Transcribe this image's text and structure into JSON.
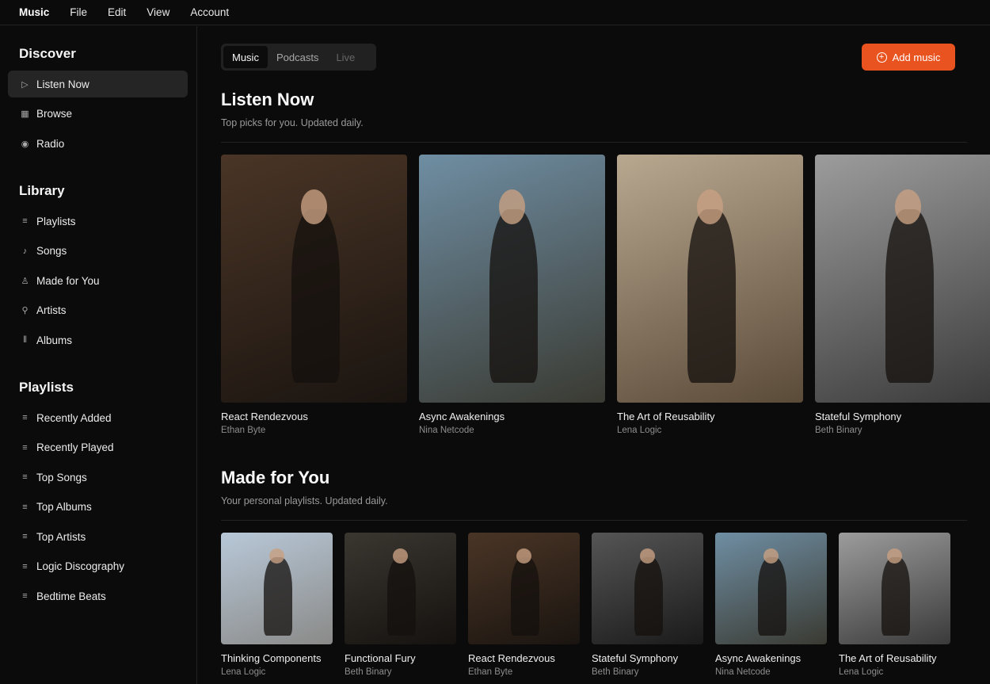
{
  "menubar": {
    "brand": "Music",
    "items": [
      "File",
      "Edit",
      "View",
      "Account"
    ]
  },
  "sidebar": {
    "discover": {
      "title": "Discover",
      "items": [
        {
          "label": "Listen Now",
          "icon": "play-circle-icon",
          "active": true
        },
        {
          "label": "Browse",
          "icon": "grid-icon"
        },
        {
          "label": "Radio",
          "icon": "radio-icon"
        }
      ]
    },
    "library": {
      "title": "Library",
      "items": [
        {
          "label": "Playlists",
          "icon": "playlist-icon"
        },
        {
          "label": "Songs",
          "icon": "music-note-icon"
        },
        {
          "label": "Made for You",
          "icon": "user-icon"
        },
        {
          "label": "Artists",
          "icon": "microphone-icon"
        },
        {
          "label": "Albums",
          "icon": "library-icon"
        }
      ]
    },
    "playlists": {
      "title": "Playlists",
      "items": [
        {
          "label": "Recently Added"
        },
        {
          "label": "Recently Played"
        },
        {
          "label": "Top Songs"
        },
        {
          "label": "Top Albums"
        },
        {
          "label": "Top Artists"
        },
        {
          "label": "Logic Discography"
        },
        {
          "label": "Bedtime Beats"
        }
      ]
    }
  },
  "tabs": [
    {
      "label": "Music",
      "active": true
    },
    {
      "label": "Podcasts"
    },
    {
      "label": "Live",
      "disabled": true
    }
  ],
  "add_button": {
    "label": "Add music",
    "color": "#e8531f"
  },
  "listen_now": {
    "title": "Listen Now",
    "subtitle": "Top picks for you. Updated daily.",
    "albums": [
      {
        "title": "React Rendezvous",
        "artist": "Ethan Byte",
        "colors": [
          "#4a3526",
          "#1a1410"
        ]
      },
      {
        "title": "Async Awakenings",
        "artist": "Nina Netcode",
        "colors": [
          "#6f8ea3",
          "#3a3a32"
        ]
      },
      {
        "title": "The Art of Reusability",
        "artist": "Lena Logic",
        "colors": [
          "#b9a890",
          "#5a4a38"
        ]
      },
      {
        "title": "Stateful Symphony",
        "artist": "Beth Binary",
        "colors": [
          "#9c9c9c",
          "#3a3a3a"
        ]
      }
    ]
  },
  "made_for_you": {
    "title": "Made for You",
    "subtitle": "Your personal playlists. Updated daily.",
    "albums": [
      {
        "title": "Thinking Components",
        "artist": "Lena Logic",
        "colors": [
          "#b8c8d8",
          "#8a8a88"
        ]
      },
      {
        "title": "Functional Fury",
        "artist": "Beth Binary",
        "colors": [
          "#3a3630",
          "#15120f"
        ]
      },
      {
        "title": "React Rendezvous",
        "artist": "Ethan Byte",
        "colors": [
          "#4a3526",
          "#1a1410"
        ]
      },
      {
        "title": "Stateful Symphony",
        "artist": "Beth Binary",
        "colors": [
          "#555",
          "#1a1a1a"
        ]
      },
      {
        "title": "Async Awakenings",
        "artist": "Nina Netcode",
        "colors": [
          "#6f8ea3",
          "#3a3a32"
        ]
      },
      {
        "title": "The Art of Reusability",
        "artist": "Lena Logic",
        "colors": [
          "#9c9c9c",
          "#3a3a3a"
        ]
      }
    ]
  }
}
